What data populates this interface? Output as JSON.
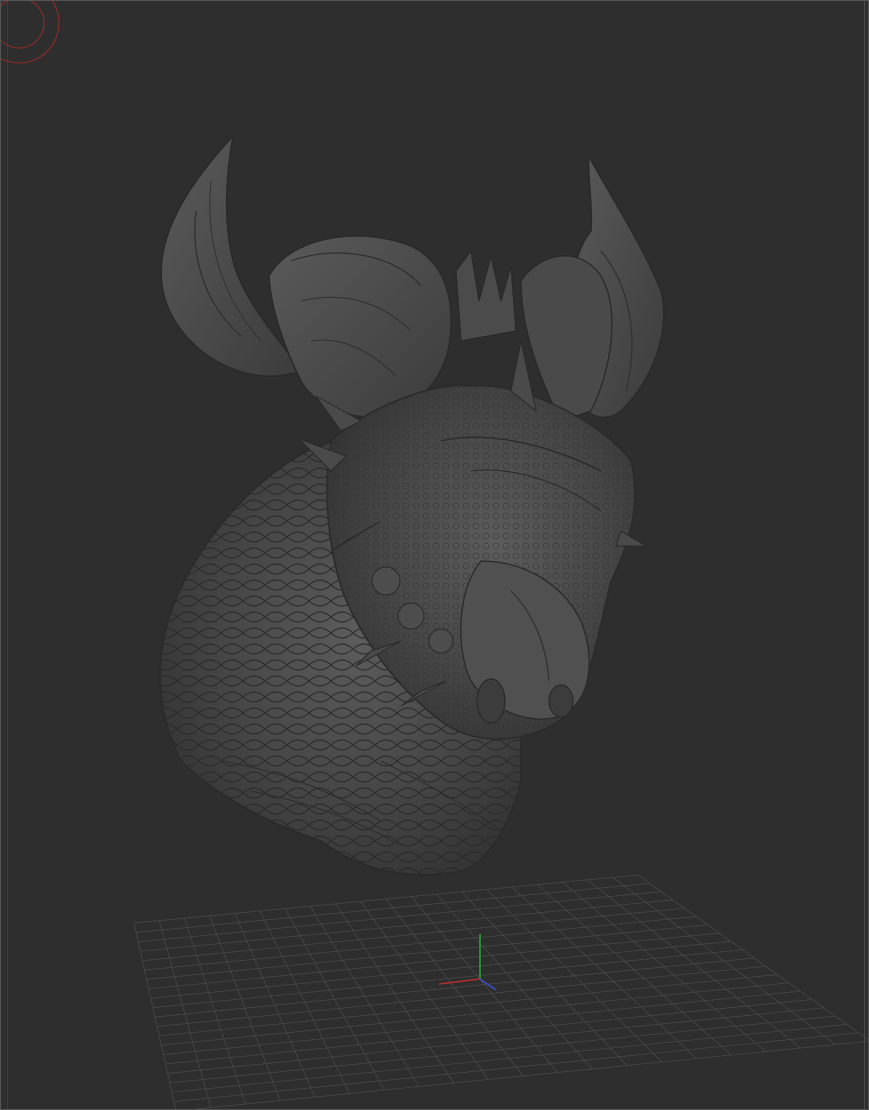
{
  "viewport": {
    "background_color": "#2e2e2e",
    "shading": "matcap-grey",
    "model": "dragon-head-sculpt",
    "grid_color": "#4a4a4a",
    "axes": {
      "x_color": "#b03030",
      "y_color": "#2ea02e",
      "z_color": "#3a4fc0"
    },
    "navigation_gizmo_color": "#a02828"
  }
}
